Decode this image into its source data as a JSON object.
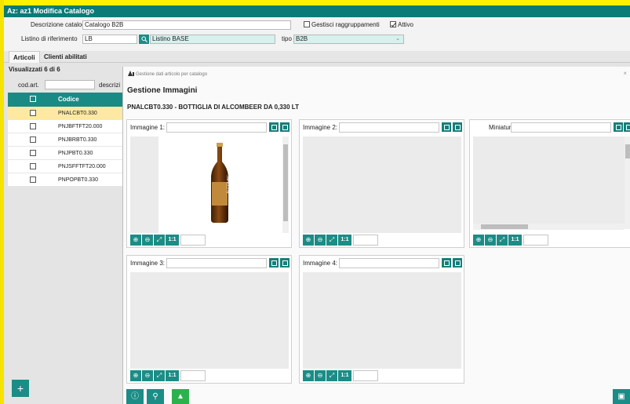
{
  "window": {
    "title": "Az: az1  Modifica Catalogo"
  },
  "form": {
    "descrizione_label": "Descrizione catalogo",
    "descrizione_value": "Catalogo B2B",
    "listino_label": "Listino di riferimento",
    "listino_code": "LB",
    "listino_name": "Listino BASE",
    "gestisci_label": "Gestisci raggruppamenti",
    "attivo_label": "Attivo",
    "tipo_label": "tipo",
    "tipo_value": "B2B"
  },
  "tabs": [
    {
      "label": "Articoli"
    },
    {
      "label": "Clienti abilitati"
    }
  ],
  "list": {
    "visualizzati": "Visualizzati 6 di 6",
    "codart_label": "cod.art.",
    "descr_label": "descrizi",
    "col_codice": "Codice",
    "rows": [
      "PNALCBT0.330",
      "PNJBFTFT20.000",
      "PNJBRBT0.330",
      "PNJPBT0.330",
      "PNJSFFTFT20.000",
      "PNPOPBT0.330"
    ]
  },
  "dialog": {
    "subtitle": "Gestione dati articolo per catalogo",
    "title": "Gestione Immagini",
    "product": "PNALCBT0.330 - BOTTIGLIA DI ALCOMBEER DA 0,330 LT",
    "close": "×",
    "cards": [
      {
        "label": "Immagine 1:"
      },
      {
        "label": "Immagine 2:"
      },
      {
        "label": "Miniatura:"
      },
      {
        "label": "Immagine 3:"
      },
      {
        "label": "Immagine 4:"
      }
    ],
    "bottle_text": "ALCOMBE",
    "zoom_fit": "1:1"
  },
  "colors": {
    "accent": "#1c8c86",
    "title_bar": "#0a7b77",
    "selected_row": "#ffe9a2",
    "highlight": "#fff100"
  }
}
